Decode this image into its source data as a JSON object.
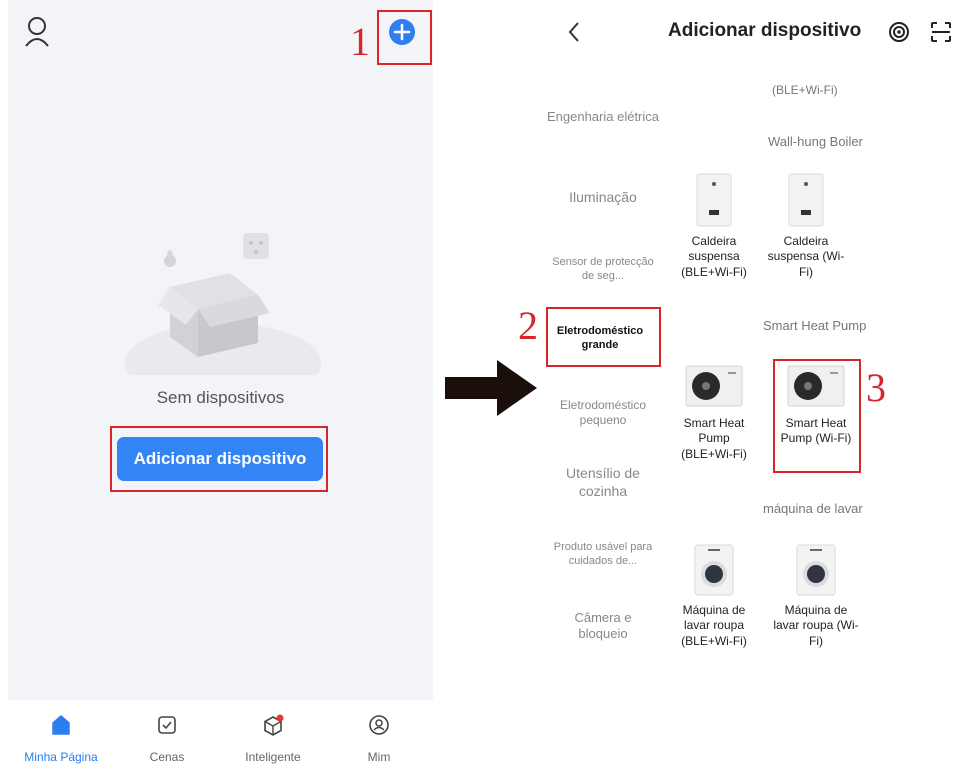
{
  "left": {
    "empty_text": "Sem dispositivos",
    "add_button": "Adicionar dispositivo",
    "tabs": [
      {
        "label": "Minha Página",
        "icon": "home-icon",
        "active": true
      },
      {
        "label": "Cenas",
        "icon": "scene-checkbox-icon",
        "active": false
      },
      {
        "label": "Inteligente",
        "icon": "smart-cube-icon",
        "active": false
      },
      {
        "label": "Mim",
        "icon": "user-circle-icon",
        "active": false
      }
    ]
  },
  "markers": [
    "1",
    "2",
    "3"
  ],
  "right": {
    "title": "Adicionar dispositivo",
    "categories": [
      {
        "label": "Engenharia elétrica",
        "active": false
      },
      {
        "label": "Iluminação",
        "active": false
      },
      {
        "label": "Sensor de protecção de seg...",
        "active": false
      },
      {
        "label": "Eletrodoméstico grande",
        "active": true
      },
      {
        "label": "Eletrodoméstico pequeno",
        "active": false
      },
      {
        "label": "Utensílio de cozinha",
        "active": false
      },
      {
        "label": "Produto usável para cuidados de...",
        "active": false
      },
      {
        "label": "Câmera e bloqueio",
        "active": false
      }
    ],
    "top_cut_text": "(BLE+Wi-Fi)",
    "sections": [
      {
        "title": "Wall-hung Boiler",
        "items": [
          {
            "label": "Caldeira suspensa (BLE+Wi-Fi)",
            "image": "boiler-image"
          },
          {
            "label": "Caldeira suspensa (Wi-Fi)",
            "image": "boiler-image"
          }
        ]
      },
      {
        "title": "Smart Heat Pump",
        "items": [
          {
            "label": "Smart Heat Pump (BLE+Wi-Fi)",
            "image": "heat-pump-image"
          },
          {
            "label": "Smart Heat Pump (Wi-Fi)",
            "image": "heat-pump-image"
          }
        ]
      },
      {
        "title": "máquina de lavar",
        "items": [
          {
            "label": "Máquina de lavar roupa (BLE+Wi-Fi)",
            "image": "washing-machine-image"
          },
          {
            "label": "Máquina de lavar roupa (Wi-Fi)",
            "image": "washing-machine-image"
          }
        ]
      }
    ]
  },
  "colors": {
    "accent": "#3385f5",
    "highlight": "#d6262b",
    "arrow": "#1a0e0a"
  }
}
